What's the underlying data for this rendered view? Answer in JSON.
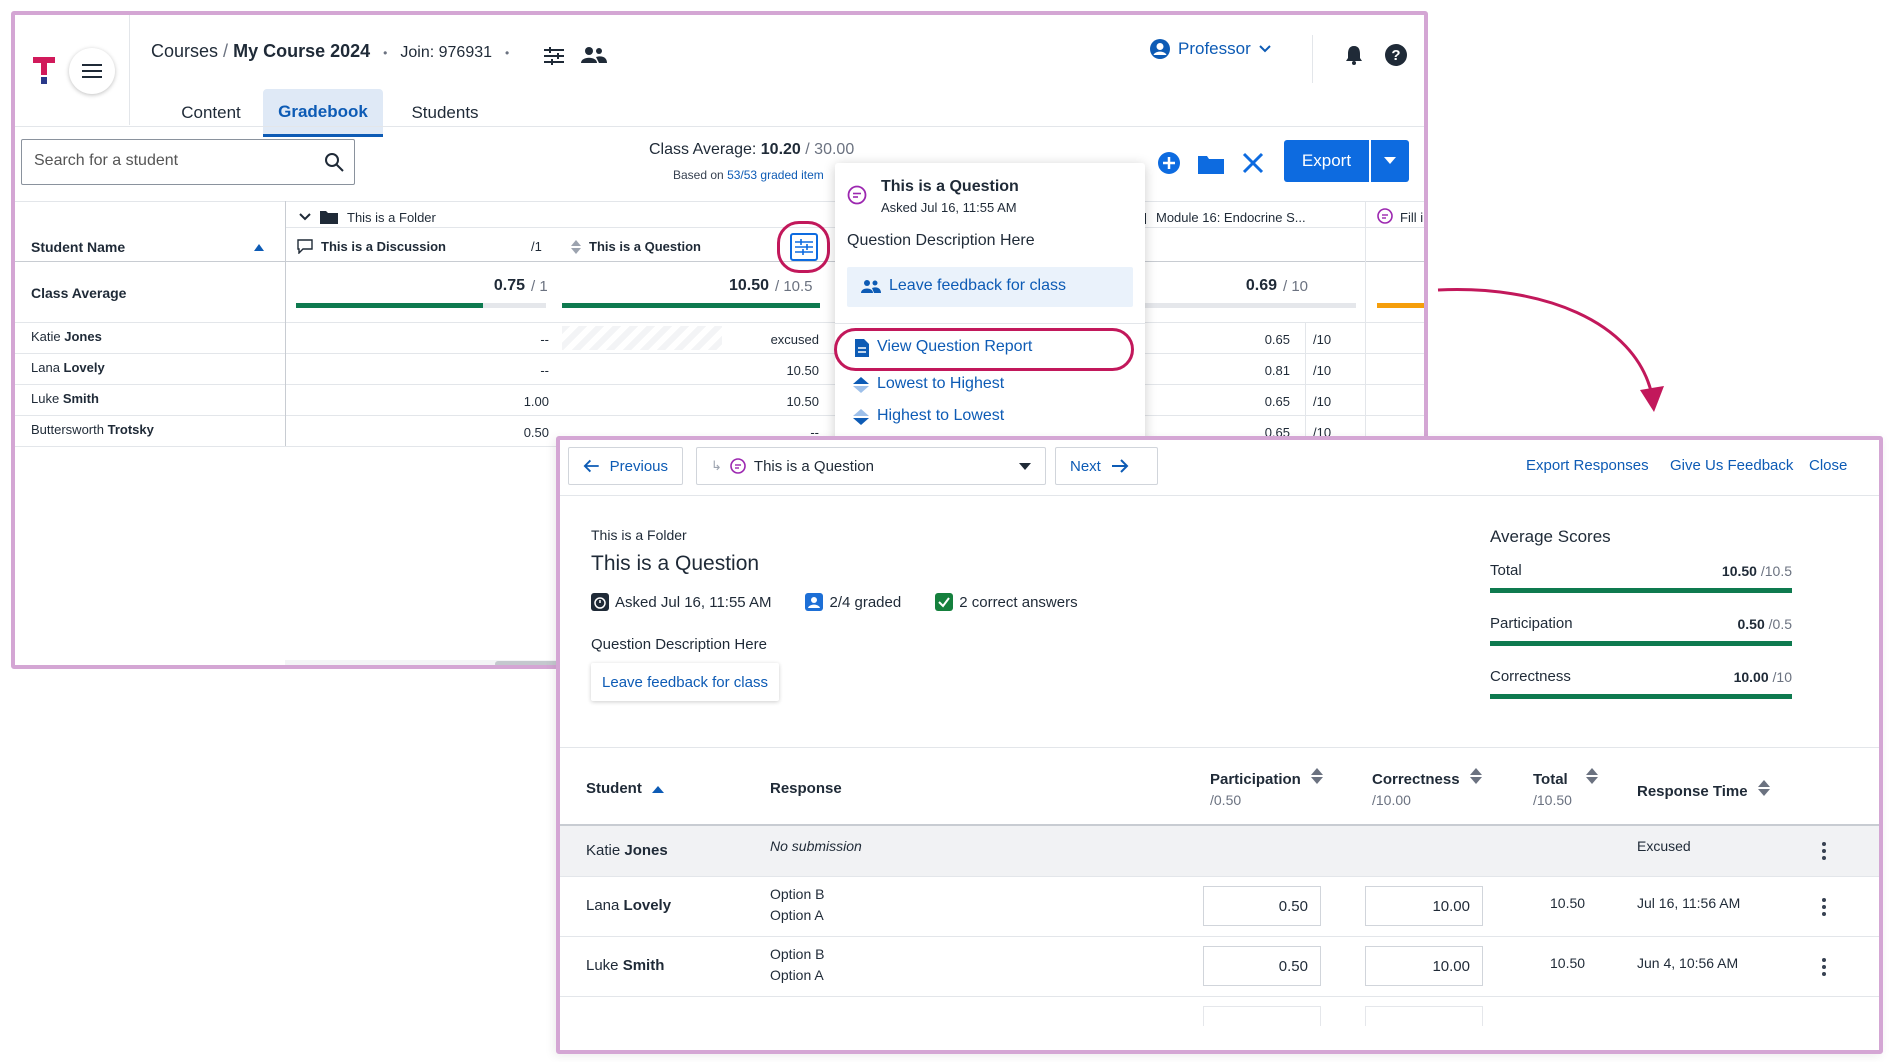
{
  "gradebook": {
    "breadcrumb": {
      "root": "Courses",
      "sep": "/",
      "course": "My Course 2024",
      "dot": "•",
      "join": "Join: 976931"
    },
    "tabs": [
      "Content",
      "Gradebook",
      "Students"
    ],
    "active_tab": "Gradebook",
    "role": "Professor",
    "search_placeholder": "Search for a student",
    "class_average": {
      "label": "Class Average:",
      "value": "10.20",
      "total": "/ 30.00"
    },
    "based_on": {
      "prefix": "Based on",
      "link": "53/53 graded item"
    },
    "export_label": "Export",
    "folder_label": "This is a Folder",
    "module_label": "Module 16: Endocrine S...",
    "fill_label": "Fill i",
    "columns": {
      "student_name": "Student Name",
      "discussion": "This is a Discussion",
      "discussion_max": "/1",
      "question": "This is a Question"
    },
    "class_avg_row": {
      "label": "Class Average",
      "discussion": "0.75",
      "discussion_max": "/ 1",
      "question": "10.50",
      "question_max": "/ 10.5",
      "module": "0.69",
      "module_max": "/ 10"
    },
    "rows": [
      {
        "first": "Katie",
        "last": "Jones",
        "discussion": "--",
        "question": "excused",
        "module": "0.65",
        "module_max": "/10"
      },
      {
        "first": "Lana",
        "last": "Lovely",
        "discussion": "--",
        "question": "10.50",
        "module": "0.81",
        "module_max": "/10"
      },
      {
        "first": "Luke",
        "last": "Smith",
        "discussion": "1.00",
        "question": "10.50",
        "module": "0.65",
        "module_max": "/10"
      },
      {
        "first": "Buttersworth",
        "last": "Trotsky",
        "discussion": "0.50",
        "question": "--",
        "module": "0.65",
        "module_max": "/10"
      }
    ],
    "popup": {
      "title": "This is a Question",
      "asked": "Asked Jul 16, 11:55 AM",
      "description": "Question Description Here",
      "feedback": "Leave feedback for class",
      "report": "View Question Report",
      "low_high": "Lowest to Highest",
      "high_low": "Highest to Lowest"
    }
  },
  "report": {
    "previous": "Previous",
    "selector": "This is a Question",
    "next": "Next",
    "export_responses": "Export Responses",
    "give_feedback": "Give Us Feedback",
    "close": "Close",
    "folder": "This is a Folder",
    "title": "This is a Question",
    "asked": "Asked Jul 16, 11:55 AM",
    "graded": "2/4 graded",
    "correct": "2 correct answers",
    "description": "Question Description Here",
    "feedback_button": "Leave feedback for class",
    "average_scores": {
      "heading": "Average Scores",
      "items": [
        {
          "label": "Total",
          "value": "10.50",
          "max": "/10.5",
          "fraction": 1.0
        },
        {
          "label": "Participation",
          "value": "0.50",
          "max": "/0.5",
          "fraction": 1.0
        },
        {
          "label": "Correctness",
          "value": "10.00",
          "max": "/10",
          "fraction": 1.0
        }
      ]
    },
    "table": {
      "headers": {
        "student": "Student",
        "response": "Response",
        "participation": "Participation",
        "participation_max": "/0.50",
        "correctness": "Correctness",
        "correctness_max": "/10.00",
        "total": "Total",
        "total_max": "/10.50",
        "response_time": "Response Time"
      },
      "rows": [
        {
          "first": "Katie",
          "last": "Jones",
          "response": "No submission",
          "time": "Excused"
        },
        {
          "first": "Lana",
          "last": "Lovely",
          "response1": "Option B",
          "response2": "Option A",
          "participation": "0.50",
          "correctness": "10.00",
          "total": "10.50",
          "time": "Jul 16, 11:56 AM"
        },
        {
          "first": "Luke",
          "last": "Smith",
          "response1": "Option B",
          "response2": "Option A",
          "participation": "0.50",
          "correctness": "10.00",
          "total": "10.50",
          "time": "Jun 4, 10:56 AM"
        }
      ]
    }
  },
  "colors": {
    "brand_blue": "#0d6be0",
    "link_blue": "#0d5bb5",
    "highlight": "#c2185b",
    "green": "#0e7a4f",
    "orange": "#f59e0b"
  }
}
